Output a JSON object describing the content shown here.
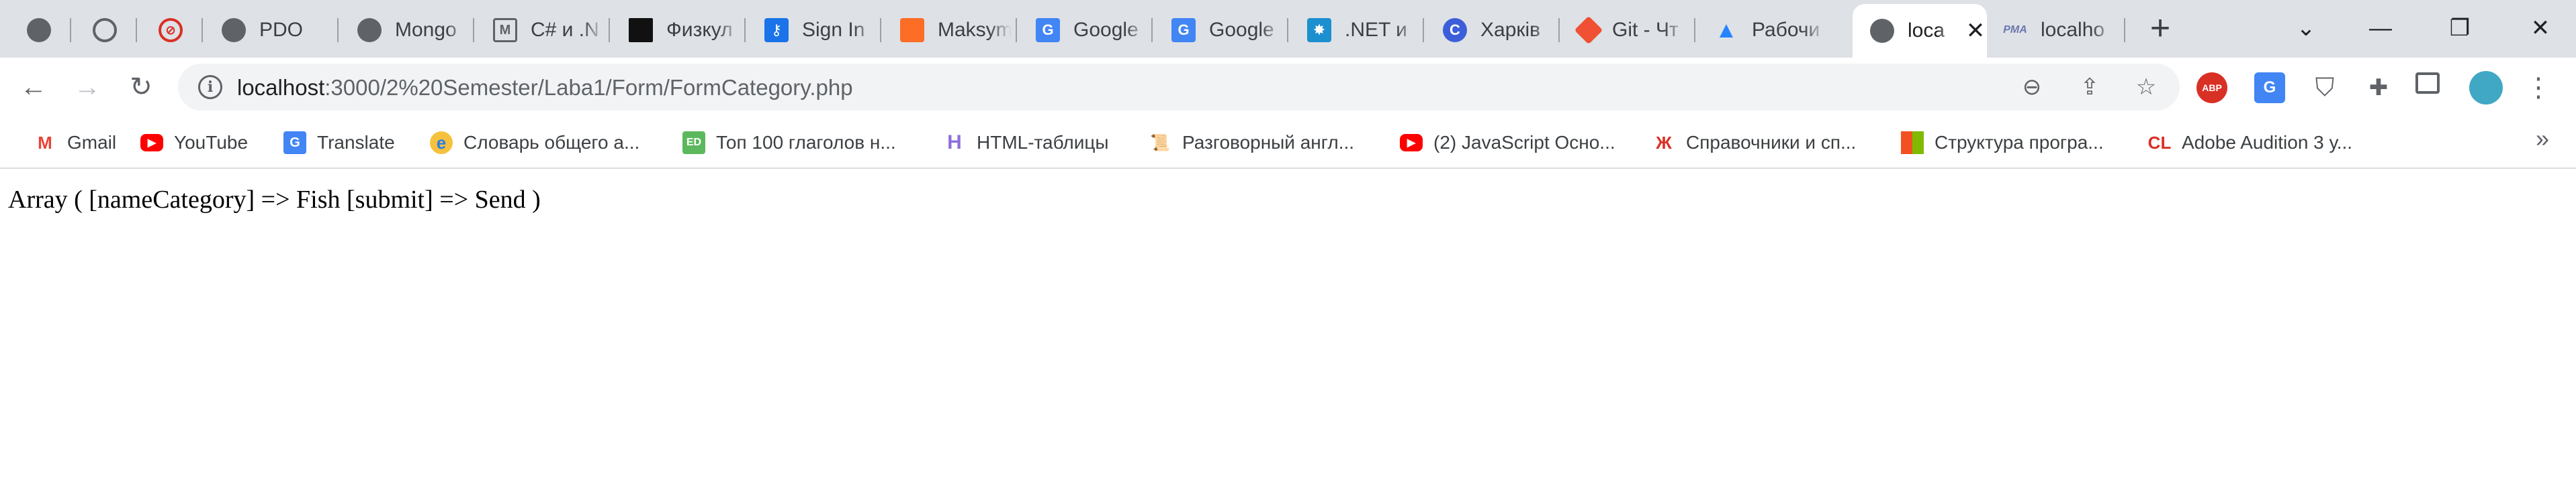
{
  "tabs": [
    {
      "title": "",
      "icon": "globe-icon"
    },
    {
      "title": "",
      "icon": "globe-icon"
    },
    {
      "title": "",
      "icon": "blocked-icon"
    },
    {
      "title": "PDO",
      "icon": "globe-icon"
    },
    {
      "title": "Mongo",
      "icon": "globe-icon"
    },
    {
      "title": "C# и .N",
      "icon": "m-icon"
    },
    {
      "title": "Физкул",
      "icon": "logo-icon"
    },
    {
      "title": "Sign In",
      "icon": "key-icon"
    },
    {
      "title": "Maksym",
      "icon": "gitlab-icon"
    },
    {
      "title": "Google",
      "icon": "google-translate-icon"
    },
    {
      "title": "Google",
      "icon": "google-translate-icon"
    },
    {
      "title": ".NET и",
      "icon": "dotnet-icon"
    },
    {
      "title": "Харків",
      "icon": "c-icon"
    },
    {
      "title": "Git - Чт",
      "icon": "git-icon"
    },
    {
      "title": "Рабочи",
      "icon": "atlassian-icon"
    },
    {
      "title": "loca",
      "icon": "globe-icon",
      "active": true
    },
    {
      "title": "localho",
      "icon": "phpmyadmin-icon"
    }
  ],
  "window": {
    "minimize": "—",
    "maximize": "❐",
    "close": "✕",
    "dropdown": "⌄"
  },
  "address_bar": {
    "host": "localhost",
    "path": ":3000/2%20Semester/Laba1/Form/FormCategory.php"
  },
  "extensions": [
    "abp-icon",
    "translate-icon",
    "shield-icon",
    "puzzle-icon",
    "sidebar-icon",
    "profile-avatar"
  ],
  "abp_label": "ABP",
  "bookmarks": [
    {
      "label": "Gmail",
      "icon": "gmail-icon",
      "glyph": "M",
      "color": "#ea4335"
    },
    {
      "label": "YouTube",
      "icon": "youtube-icon",
      "glyph": "▶",
      "color": "#ff0000"
    },
    {
      "label": "Translate",
      "icon": "google-translate-icon",
      "glyph": "G",
      "color": "#4285f4"
    },
    {
      "label": "Словарь общего а...",
      "icon": "e-icon",
      "glyph": "e",
      "color": "#2b7de9"
    },
    {
      "label": "Топ 100 глаголов н...",
      "icon": "ed-icon",
      "glyph": "ED",
      "color": "#5cb85c"
    },
    {
      "label": "HTML-таблицы",
      "icon": "h-icon",
      "glyph": "H",
      "color": "#8e6fd8"
    },
    {
      "label": "Разговорный англ...",
      "icon": "scroll-icon",
      "glyph": "📜",
      "color": "#202124"
    },
    {
      "label": "(2) JavaScript Осно...",
      "icon": "youtube-icon",
      "glyph": "▶",
      "color": "#ff0000"
    },
    {
      "label": "Справочники и сп...",
      "icon": "tower-icon",
      "glyph": "Ж",
      "color": "#d93025"
    },
    {
      "label": "Структура програ...",
      "icon": "microsoft-icon",
      "glyph": "▦",
      "color": "#f25022"
    },
    {
      "label": "Adobe Audition 3 у...",
      "icon": "cl-icon",
      "glyph": "CL",
      "color": "#d93025"
    }
  ],
  "more_bookmarks": "»",
  "page": {
    "output": "Array ( [nameCategory] => Fish [submit] => Send )"
  }
}
